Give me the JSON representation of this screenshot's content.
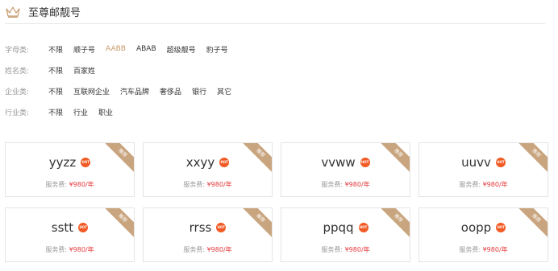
{
  "header": {
    "title": "至尊邮靓号",
    "icon": "crown-icon"
  },
  "filters": [
    {
      "label": "字母类:",
      "options": [
        "不限",
        "顺子号",
        "AABB",
        "ABAB",
        "超级靓号",
        "豹子号"
      ],
      "active": 2
    },
    {
      "label": "姓名类:",
      "options": [
        "不限",
        "百家姓"
      ],
      "active": -1
    },
    {
      "label": "企业类:",
      "options": [
        "不限",
        "互联网企业",
        "汽车品牌",
        "奢侈品",
        "银行",
        "其它"
      ],
      "active": -1
    },
    {
      "label": "行业类:",
      "options": [
        "不限",
        "行业",
        "职业"
      ],
      "active": -1
    }
  ],
  "cards": [
    {
      "name": "yyzz",
      "price_label": "服务费: ",
      "price": "¥980/年",
      "hot": "HOT",
      "ribbon": "推荐"
    },
    {
      "name": "xxyy",
      "price_label": "服务费: ",
      "price": "¥980/年",
      "hot": "HOT",
      "ribbon": "推荐"
    },
    {
      "name": "vvww",
      "price_label": "服务费: ",
      "price": "¥980/年",
      "hot": "HOT",
      "ribbon": "推荐"
    },
    {
      "name": "uuvv",
      "price_label": "服务费: ",
      "price": "¥980/年",
      "hot": "HOT",
      "ribbon": "推荐"
    },
    {
      "name": "sstt",
      "price_label": "服务费: ",
      "price": "¥980/年",
      "hot": "HOT",
      "ribbon": "推荐"
    },
    {
      "name": "rrss",
      "price_label": "服务费: ",
      "price": "¥980/年",
      "hot": "HOT",
      "ribbon": "推荐"
    },
    {
      "name": "ppqq",
      "price_label": "服务费: ",
      "price": "¥980/年",
      "hot": "HOT",
      "ribbon": "推荐"
    },
    {
      "name": "oopp",
      "price_label": "服务费: ",
      "price": "¥980/年",
      "hot": "HOT",
      "ribbon": "推荐"
    }
  ],
  "colors": {
    "accent": "#c79a6c",
    "price": "#e4393c",
    "hot": "#f15a24",
    "ribbon": "#c9a57f"
  }
}
